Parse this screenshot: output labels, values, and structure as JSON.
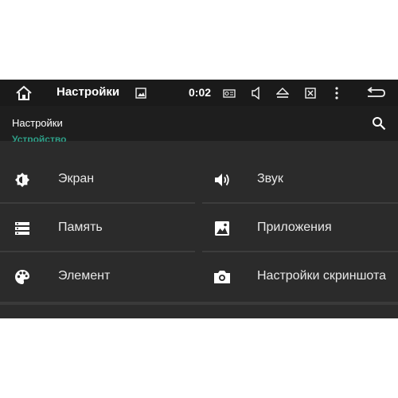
{
  "system_bar": {
    "title": "Настройки",
    "time": "0:02",
    "icons": [
      "home-icon",
      "image-icon",
      "radio-icon",
      "volume-icon",
      "eject-icon",
      "close-box-icon",
      "more-vert-icon",
      "back-icon"
    ]
  },
  "app_bar": {
    "title": "Настройки",
    "search_icon": "search-icon"
  },
  "section": {
    "header": "Устройство"
  },
  "tiles": [
    {
      "label": "Экран",
      "icon": "brightness-icon"
    },
    {
      "label": "Звук",
      "icon": "speaker-icon"
    },
    {
      "label": "Память",
      "icon": "storage-icon"
    },
    {
      "label": "Приложения",
      "icon": "apps-icon"
    },
    {
      "label": "Элемент",
      "icon": "palette-icon"
    },
    {
      "label": "Настройки скриншота",
      "icon": "camera-icon"
    }
  ],
  "colors": {
    "background": "#2b2b2b",
    "system_bar": "#1a1a1a",
    "app_bar": "#1e1e1e",
    "accent": "#2e9e87",
    "text": "#e8e8e8"
  }
}
